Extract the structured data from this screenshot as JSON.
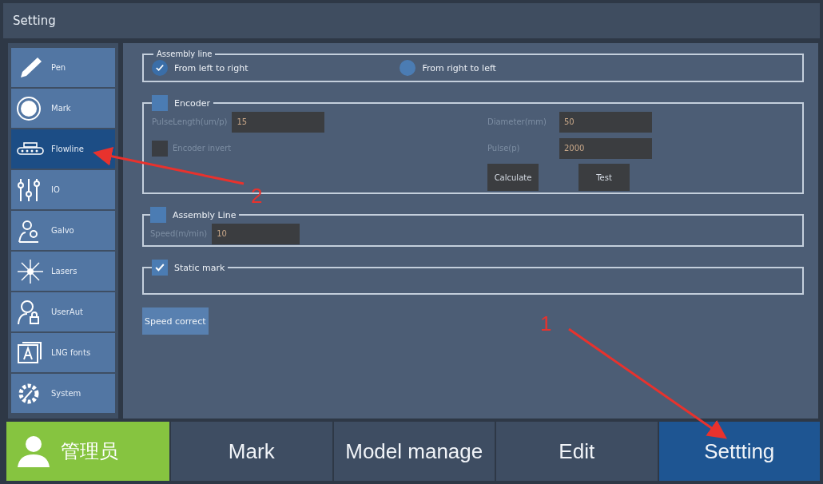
{
  "window": {
    "title": "Setting"
  },
  "sidebar": {
    "items": [
      {
        "label": "Pen",
        "selected": false
      },
      {
        "label": "Mark",
        "selected": false
      },
      {
        "label": "Flowline",
        "selected": true
      },
      {
        "label": "IO",
        "selected": false
      },
      {
        "label": "Galvo",
        "selected": false
      },
      {
        "label": "Lasers",
        "selected": false
      },
      {
        "label": "UserAut",
        "selected": false
      },
      {
        "label": "LNG  fonts",
        "selected": false
      },
      {
        "label": "System",
        "selected": false
      }
    ]
  },
  "direction_group": {
    "title": "Assembly line",
    "options": [
      {
        "label": "From left to right",
        "selected": true
      },
      {
        "label": "From right to left",
        "selected": false
      }
    ]
  },
  "encoder_group": {
    "title": "Encoder",
    "checked": false,
    "left_fields": [
      {
        "label": "PulseLength(um/p)",
        "value": "15"
      }
    ],
    "invert": {
      "label": "Encoder invert",
      "checked": false
    },
    "right_fields": [
      {
        "label": "Diameter(mm)",
        "value": "50"
      },
      {
        "label": "Pulse(p)",
        "value": "2000"
      }
    ],
    "buttons": [
      "Calculate",
      "Test"
    ]
  },
  "assembly_group": {
    "title": "Assembly Line",
    "checked": false,
    "fields": [
      {
        "label": "Speed(m/min)",
        "value": "10"
      }
    ]
  },
  "static_group": {
    "title": "Static mark",
    "checked": true
  },
  "speed_button": "Speed correct",
  "user": {
    "name": "管理员"
  },
  "tabs": [
    {
      "label": "Mark",
      "selected": false
    },
    {
      "label": "Model manage",
      "selected": false
    },
    {
      "label": "Edit",
      "selected": false
    },
    {
      "label": "Settting",
      "selected": true
    }
  ],
  "annotations": [
    {
      "label": "2"
    },
    {
      "label": "1"
    }
  ]
}
